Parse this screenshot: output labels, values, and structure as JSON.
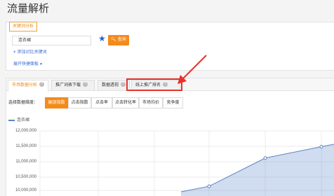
{
  "page": {
    "title": "流量解析"
  },
  "keyword_panel": {
    "tab_label": "关键词分析",
    "input_value": "连衣裙",
    "search_button": "查询",
    "search_icon": "search-icon",
    "star_icon": "star-icon",
    "add_link": "添加对比关键词",
    "expand_link": "展开快捷面板"
  },
  "tabs": [
    {
      "label": "市场数据分析",
      "active": true
    },
    {
      "label": "推广词表下载",
      "active": false
    },
    {
      "label": "数据透视",
      "active": false
    },
    {
      "label": "线上推广排名",
      "active": false
    }
  ],
  "dimension": {
    "label": "选择数据维度：",
    "options": [
      "展现指数",
      "点击指数",
      "点击率",
      "点击转化率",
      "市场均价",
      "竞争度"
    ],
    "selected": "展现指数"
  },
  "colors": {
    "accent": "#f38b1b",
    "highlight": "#e8332c",
    "series": "#5b84c4",
    "link": "#3b6fcf"
  },
  "chart_data": {
    "type": "area",
    "yticks": [
      "12,000,000",
      "11,500,000",
      "11,000,000",
      "10,500,000",
      "10,000,000"
    ],
    "ylim": [
      9850000,
      12000000
    ],
    "series": [
      {
        "name": "连衣裙",
        "values": [
          9800000,
          10000000,
          11020000,
          11430000,
          11520000
        ]
      }
    ],
    "grid": true,
    "legend": "top-left"
  }
}
